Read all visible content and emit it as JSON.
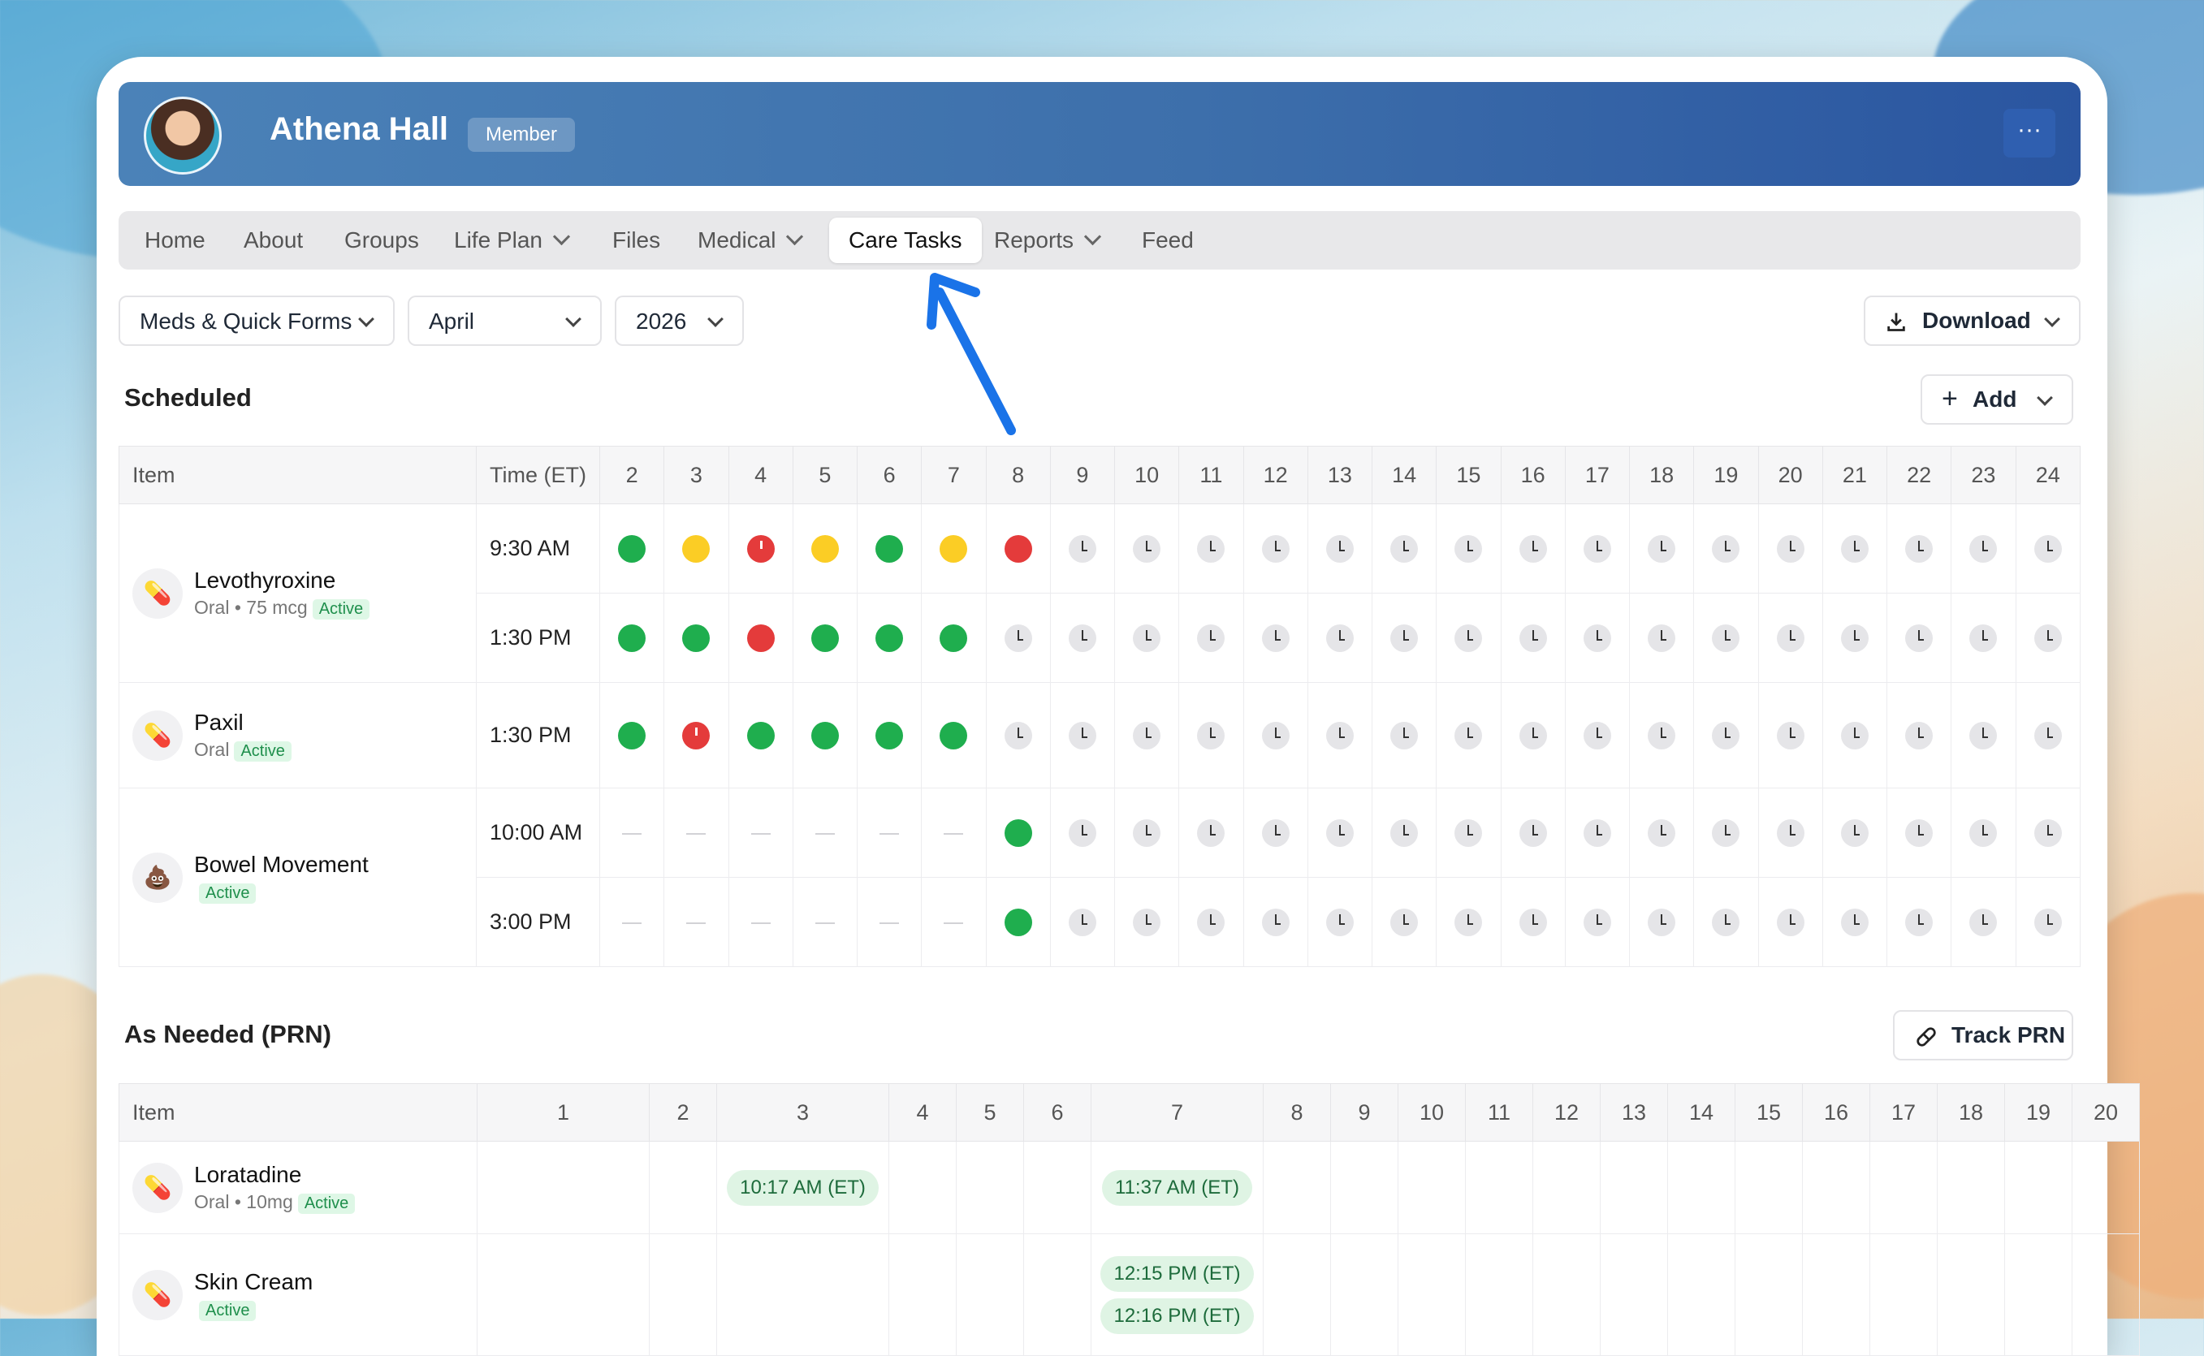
{
  "header": {
    "name": "Athena Hall",
    "role": "Member",
    "more": "···"
  },
  "tabs": {
    "home": "Home",
    "about": "About",
    "groups": "Groups",
    "life_plan": "Life Plan",
    "files": "Files",
    "medical": "Medical",
    "care_tasks": "Care Tasks",
    "reports": "Reports",
    "feed": "Feed"
  },
  "filters": {
    "type": "Meds & Quick Forms",
    "month": "April",
    "year": "2026"
  },
  "toolbar": {
    "download": "Download",
    "add": "Add",
    "track_prn": "Track PRN"
  },
  "scheduled": {
    "title": "Scheduled",
    "col_item": "Item",
    "col_time": "Time (ET)",
    "days": [
      "2",
      "3",
      "4",
      "5",
      "6",
      "7",
      "8",
      "9",
      "10",
      "11",
      "12",
      "13",
      "14",
      "15",
      "16",
      "17",
      "18",
      "19",
      "20",
      "21",
      "22",
      "23",
      "24"
    ],
    "rows": [
      {
        "name": "Levothyroxine",
        "sub": "Oral • 75 mcg",
        "status": "Active",
        "icon": "pill-icon",
        "times": [
          {
            "time": "9:30 AM",
            "cells": [
              "g",
              "y",
              "rc",
              "y",
              "g",
              "y",
              "r",
              "c",
              "c",
              "c",
              "c",
              "c",
              "c",
              "c",
              "c",
              "c",
              "c",
              "c",
              "c",
              "c",
              "c",
              "c",
              "c"
            ]
          },
          {
            "time": "1:30 PM",
            "cells": [
              "g",
              "g",
              "r",
              "g",
              "g",
              "g",
              "c",
              "c",
              "c",
              "c",
              "c",
              "c",
              "c",
              "c",
              "c",
              "c",
              "c",
              "c",
              "c",
              "c",
              "c",
              "c",
              "c"
            ]
          }
        ]
      },
      {
        "name": "Paxil",
        "sub": "Oral",
        "status": "Active",
        "icon": "pill-icon",
        "times": [
          {
            "time": "1:30 PM",
            "cells": [
              "g",
              "rc",
              "g",
              "g",
              "g",
              "g",
              "c",
              "c",
              "c",
              "c",
              "c",
              "c",
              "c",
              "c",
              "c",
              "c",
              "c",
              "c",
              "c",
              "c",
              "c",
              "c",
              "c"
            ]
          }
        ]
      },
      {
        "name": "Bowel Movement",
        "sub": "",
        "status": "Active",
        "icon": "poop-icon",
        "times": [
          {
            "time": "10:00 AM",
            "cells": [
              "-",
              "-",
              "-",
              "-",
              "-",
              "-",
              "g",
              "c",
              "c",
              "c",
              "c",
              "c",
              "c",
              "c",
              "c",
              "c",
              "c",
              "c",
              "c",
              "c",
              "c",
              "c",
              "c"
            ]
          },
          {
            "time": "3:00 PM",
            "cells": [
              "-",
              "-",
              "-",
              "-",
              "-",
              "-",
              "g",
              "c",
              "c",
              "c",
              "c",
              "c",
              "c",
              "c",
              "c",
              "c",
              "c",
              "c",
              "c",
              "c",
              "c",
              "c",
              "c"
            ]
          }
        ]
      }
    ]
  },
  "prn": {
    "title": "As Needed (PRN)",
    "col_item": "Item",
    "days": [
      "1",
      "2",
      "3",
      "4",
      "5",
      "6",
      "7",
      "8",
      "9",
      "10",
      "11",
      "12",
      "13",
      "14",
      "15",
      "16",
      "17",
      "18",
      "19",
      "20"
    ],
    "rows": [
      {
        "name": "Loratadine",
        "sub": "Oral • 10mg",
        "status": "Active",
        "icon": "pill-icon",
        "entries": {
          "3": [
            "10:17 AM (ET)"
          ],
          "7": [
            "11:37 AM (ET)"
          ]
        }
      },
      {
        "name": "Skin Cream",
        "sub": "",
        "status": "Active",
        "icon": "pill-icon",
        "entries": {
          "7": [
            "12:15 PM (ET)",
            "12:16 PM (ET)"
          ]
        }
      }
    ]
  },
  "colors": {
    "done": "#1fae4e",
    "late": "#fbcd25",
    "missed": "#e43b3b",
    "pending": "#e5e5e8",
    "header_start": "#4b82b8",
    "header_end": "#2a55a0",
    "arrow": "#1a73e8"
  }
}
